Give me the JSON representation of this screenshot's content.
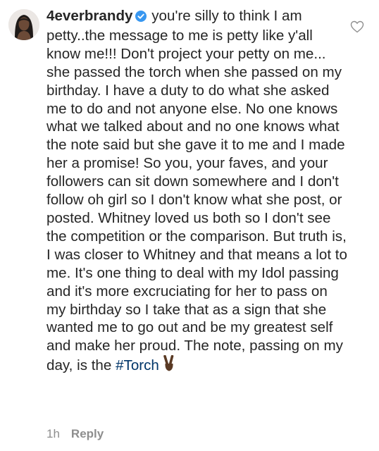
{
  "comment": {
    "username": "4everbrandy",
    "verified_icon": "verified-badge-icon",
    "text": "you're silly to think I am petty..the message to me is petty like y'all know me!!! Don't project your petty on me... she passed the torch when she passed on my birthday. I have a duty to do what she asked me to do and not anyone else. No one knows what we talked about and no one knows what the note said but she gave it to me and I made her a promise! So you, your faves, and your followers can sit down somewhere and I don't follow oh girl so I don't know what she post, or posted. Whitney loved us both so I don't see the competition or the comparison. But truth is, I was closer to Whitney and that means a lot to me. It's one thing to deal with my Idol passing and it's more excruciating for her to pass on my birthday so I take that as a sign that she wanted me to go out and be my greatest self and make her proud. The note, passing on my day, is the",
    "hashtag": "#Torch",
    "emoji": "victory-hand-emoji",
    "timestamp": "1h",
    "reply_label": "Reply"
  },
  "colors": {
    "text": "#262626",
    "meta": "#8e8e8e",
    "hashtag": "#003569",
    "verified": "#3897f0"
  },
  "icons": {
    "like": "heart-outline-icon",
    "avatar": "profile-avatar"
  }
}
